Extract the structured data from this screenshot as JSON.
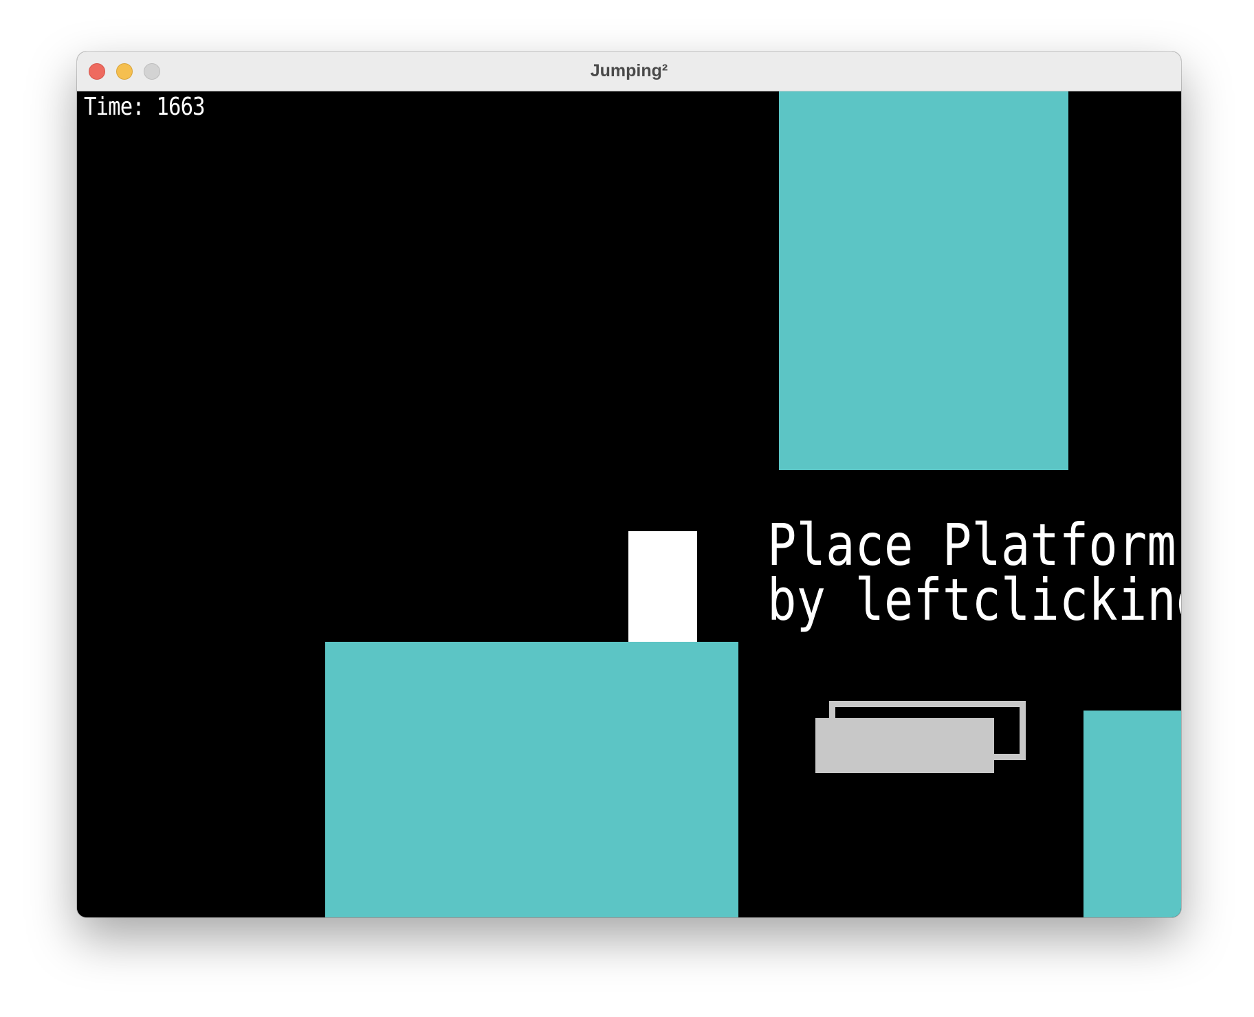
{
  "window": {
    "title": "Jumping²"
  },
  "hud": {
    "time_text": "Time: 1663"
  },
  "hint": {
    "line1": "Place Platforms",
    "line2": "by leftclicking"
  },
  "colors": {
    "background": "#000000",
    "platform": "#5cc5c5",
    "player": "#ffffff",
    "ghost_platform": "#c8c8c8",
    "text": "#ffffff"
  }
}
